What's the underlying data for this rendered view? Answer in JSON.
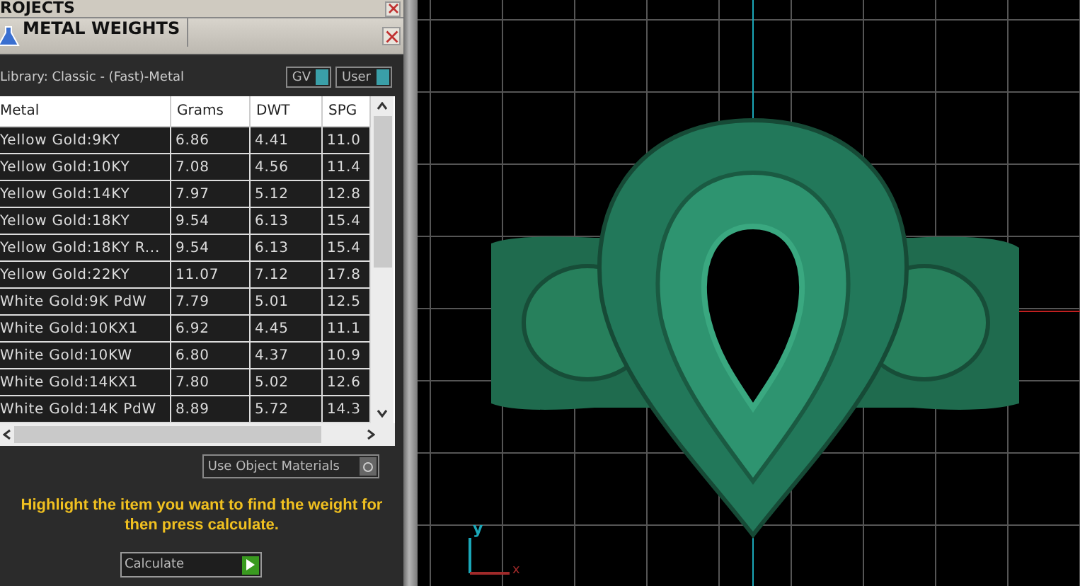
{
  "projects_bar": {
    "title": "ROJECTS"
  },
  "panel": {
    "title": "METAL WEIGHTS",
    "library": "Library: Classic - (Fast)-Metal",
    "toggles": [
      {
        "label": "GV",
        "on": true
      },
      {
        "label": "User",
        "on": true
      }
    ]
  },
  "table": {
    "columns": [
      "Metal",
      "Grams",
      "DWT",
      "SPG"
    ],
    "rows": [
      [
        "Yellow Gold:9KY",
        "6.86",
        "4.41",
        "11.0"
      ],
      [
        "Yellow Gold:10KY",
        "7.08",
        "4.56",
        "11.4"
      ],
      [
        "Yellow Gold:14KY",
        "7.97",
        "5.12",
        "12.8"
      ],
      [
        "Yellow Gold:18KY",
        "9.54",
        "6.13",
        "15.4"
      ],
      [
        "Yellow Gold:18KY R...",
        "9.54",
        "6.13",
        "15.4"
      ],
      [
        "Yellow Gold:22KY",
        "11.07",
        "7.12",
        "17.8"
      ],
      [
        "White Gold:9K PdW",
        "7.79",
        "5.01",
        "12.5"
      ],
      [
        "White Gold:10KX1",
        "6.92",
        "4.45",
        "11.1"
      ],
      [
        "White Gold:10KW",
        "6.80",
        "4.37",
        "10.9"
      ],
      [
        "White Gold:14KX1",
        "7.80",
        "5.02",
        "12.6"
      ],
      [
        "White Gold:14K PdW",
        "8.89",
        "5.72",
        "14.3"
      ]
    ]
  },
  "use_object_materials": {
    "label": "Use Object Materials"
  },
  "hint": "Highlight the item you want to find the weight for then press calculate.",
  "calculate_button": "Calculate",
  "viewport": {
    "axis_labels": [
      "y",
      "x"
    ]
  }
}
